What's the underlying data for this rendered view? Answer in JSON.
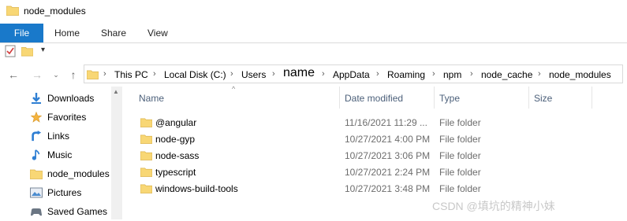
{
  "window": {
    "title": "node_modules"
  },
  "ribbon": {
    "file": "File",
    "home": "Home",
    "share": "Share",
    "view": "View"
  },
  "quick_access": {
    "dropdown": "▾"
  },
  "address": {
    "crumbs": [
      "This PC",
      "Local Disk (C:)",
      "Users",
      "name",
      "AppData",
      "Roaming",
      "npm",
      "node_cache",
      "node_modules"
    ]
  },
  "sidebar": {
    "items": [
      {
        "label": "Downloads",
        "icon": "download-arrow-icon"
      },
      {
        "label": "Favorites",
        "icon": "star-icon"
      },
      {
        "label": "Links",
        "icon": "link-arrow-icon"
      },
      {
        "label": "Music",
        "icon": "music-note-icon"
      },
      {
        "label": "node_modules",
        "icon": "folder-icon"
      },
      {
        "label": "Pictures",
        "icon": "pictures-icon"
      },
      {
        "label": "Saved Games",
        "icon": "saved-games-icon"
      }
    ]
  },
  "columns": {
    "name": "Name",
    "date": "Date modified",
    "type": "Type",
    "size": "Size"
  },
  "files": [
    {
      "name": "@angular",
      "date": "11/16/2021 11:29 ...",
      "type": "File folder"
    },
    {
      "name": "node-gyp",
      "date": "10/27/2021 4:00 PM",
      "type": "File folder"
    },
    {
      "name": "node-sass",
      "date": "10/27/2021 3:06 PM",
      "type": "File folder"
    },
    {
      "name": "typescript",
      "date": "10/27/2021 2:24 PM",
      "type": "File folder"
    },
    {
      "name": "windows-build-tools",
      "date": "10/27/2021 3:48 PM",
      "type": "File folder"
    }
  ],
  "watermark": "CSDN @填坑的精神小妹",
  "colors": {
    "accent": "#1979ca",
    "folder": "#f8d775",
    "header_text": "#4c607a"
  }
}
